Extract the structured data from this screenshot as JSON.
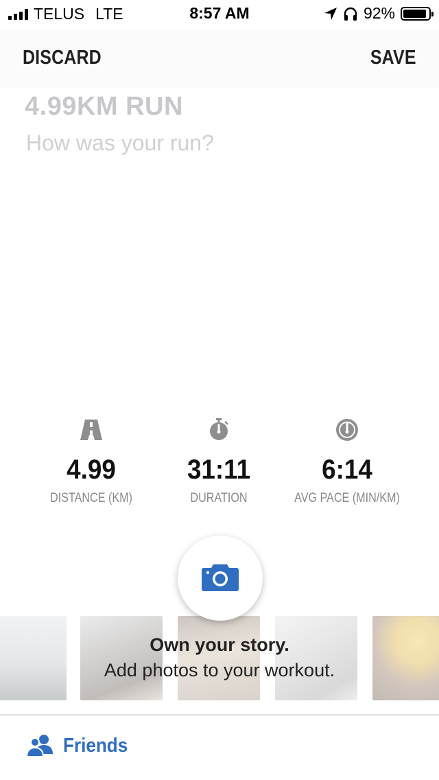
{
  "status_bar": {
    "carrier": "TELUS",
    "network": "LTE",
    "time": "8:57 AM",
    "battery": "92%",
    "battery_level": 0.92,
    "icons": [
      "signal-icon",
      "location-arrow-icon",
      "headphones-icon",
      "battery-icon"
    ]
  },
  "nav": {
    "discard_label": "DISCARD",
    "save_label": "SAVE"
  },
  "workout": {
    "title": "4.99KM RUN",
    "notes_placeholder": "How was your run?"
  },
  "stats": [
    {
      "icon": "road-icon",
      "value": "4.99",
      "label": "DISTANCE (KM)"
    },
    {
      "icon": "stopwatch-icon",
      "value": "31:11",
      "label": "DURATION"
    },
    {
      "icon": "speedometer-icon",
      "value": "6:14",
      "label": "AVG PACE (MIN/KM)"
    }
  ],
  "photos": {
    "camera_icon": "camera-icon",
    "heading": "Own your story.",
    "subheading": "Add photos to your workout."
  },
  "bottom": {
    "friends_label": "Friends",
    "friends_icon": "friends-icon"
  },
  "colors": {
    "accent": "#2f6ec0",
    "muted_text": "#c7c7cc",
    "stat_label": "#8a8a8a",
    "icon_gray": "#8e8e8e"
  }
}
